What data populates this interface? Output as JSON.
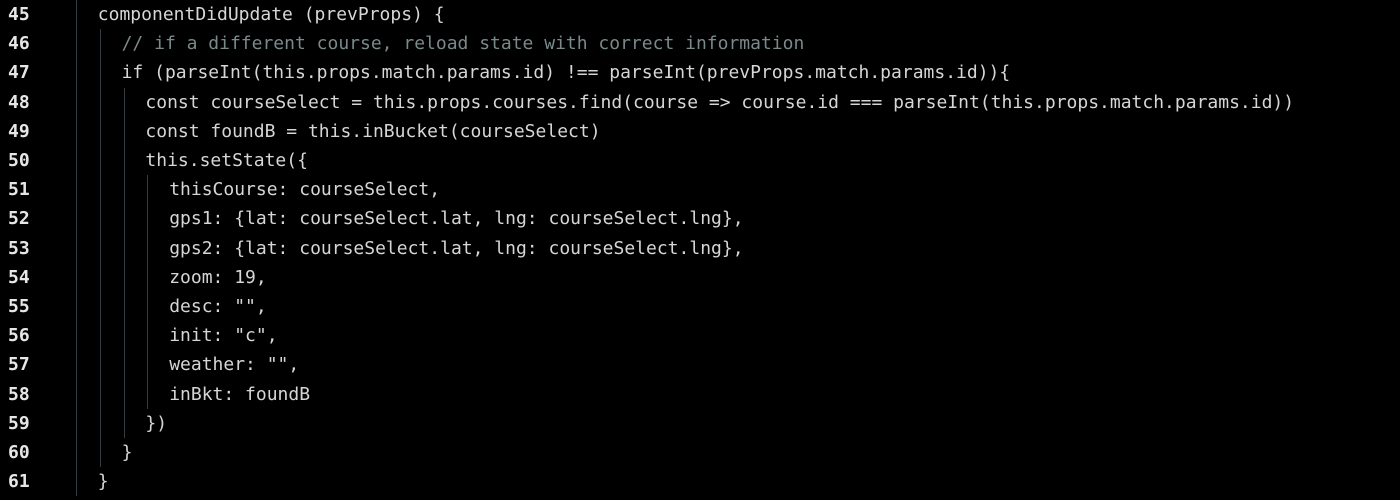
{
  "editor": {
    "lines": [
      {
        "number": "45",
        "indent": 1,
        "text": "componentDidUpdate (prevProps) {"
      },
      {
        "number": "46",
        "indent": 2,
        "text": "// if a different course, reload state with correct information"
      },
      {
        "number": "47",
        "indent": 2,
        "text": "if (parseInt(this.props.match.params.id) !== parseInt(prevProps.match.params.id)){"
      },
      {
        "number": "48",
        "indent": 3,
        "text": "const courseSelect = this.props.courses.find(course => course.id === parseInt(this.props.match.params.id))"
      },
      {
        "number": "49",
        "indent": 3,
        "text": "const foundB = this.inBucket(courseSelect)"
      },
      {
        "number": "50",
        "indent": 3,
        "text": "this.setState({"
      },
      {
        "number": "51",
        "indent": 4,
        "text": "thisCourse: courseSelect,"
      },
      {
        "number": "52",
        "indent": 4,
        "text": "gps1: {lat: courseSelect.lat, lng: courseSelect.lng},"
      },
      {
        "number": "53",
        "indent": 4,
        "text": "gps2: {lat: courseSelect.lat, lng: courseSelect.lng},"
      },
      {
        "number": "54",
        "indent": 4,
        "text": "zoom: 19,"
      },
      {
        "number": "55",
        "indent": 4,
        "text": "desc: \"\","
      },
      {
        "number": "56",
        "indent": 4,
        "text": "init: \"c\","
      },
      {
        "number": "57",
        "indent": 4,
        "text": "weather: \"\","
      },
      {
        "number": "58",
        "indent": 4,
        "text": "inBkt: foundB"
      },
      {
        "number": "59",
        "indent": 3,
        "text": "})"
      },
      {
        "number": "60",
        "indent": 2,
        "text": "}"
      },
      {
        "number": "61",
        "indent": 1,
        "text": "}"
      }
    ]
  },
  "colors": {
    "background": "#000000",
    "text": "#d6d6d6",
    "line_number": "#e6e6e6",
    "comment": "#7a8a8a",
    "indent_guide": "#333a40"
  }
}
